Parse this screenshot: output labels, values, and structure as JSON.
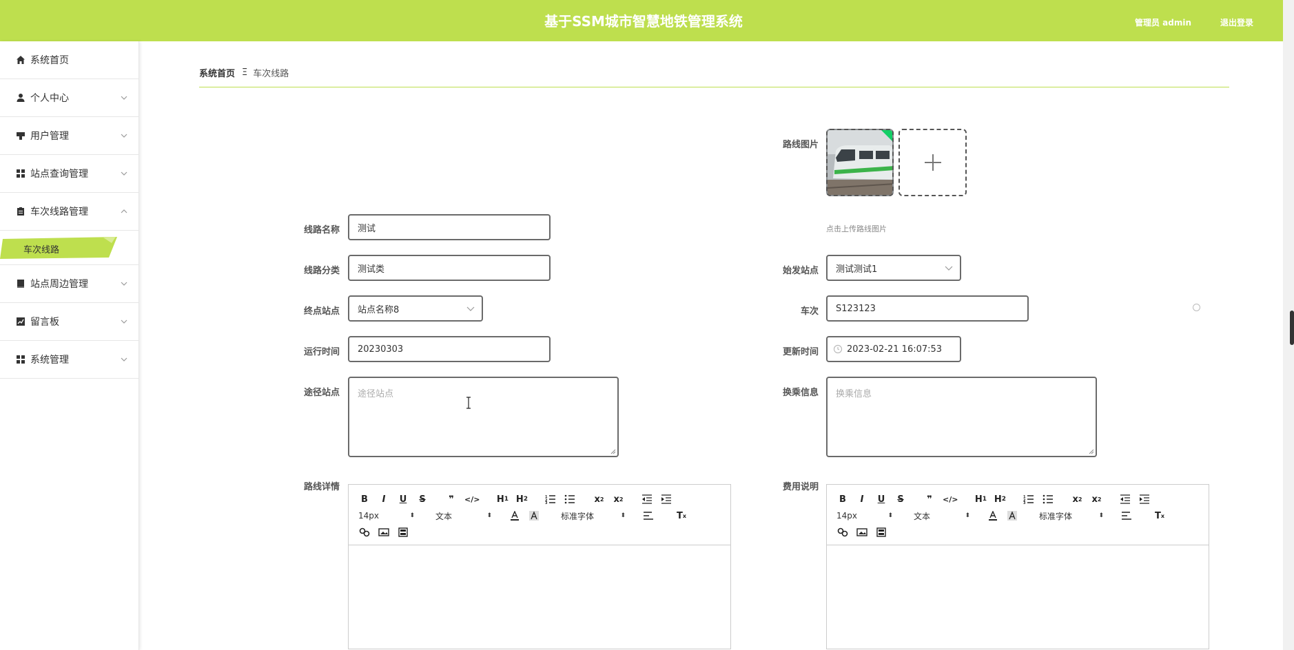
{
  "header": {
    "title": "基于SSM城市智慧地铁管理系统",
    "user": "管理员 admin",
    "logout": "退出登录"
  },
  "sidebar": {
    "items": [
      {
        "label": "系统首页",
        "icon": "home-icon"
      },
      {
        "label": "个人中心",
        "icon": "user-icon"
      },
      {
        "label": "用户管理",
        "icon": "user-manage-icon"
      },
      {
        "label": "站点查询管理",
        "icon": "grid-icon"
      },
      {
        "label": "车次线路管理",
        "icon": "clipboard-icon"
      },
      {
        "label": "站点周边管理",
        "icon": "book-icon"
      },
      {
        "label": "留言板",
        "icon": "chart-icon"
      },
      {
        "label": "系统管理",
        "icon": "grid-icon"
      }
    ],
    "active_sub": "车次线路"
  },
  "breadcrumb": {
    "home": "系统首页",
    "separator": "Ξ",
    "current": "车次线路"
  },
  "form": {
    "route_image_label": "路线图片",
    "upload_tip": "点击上传路线图片",
    "route_name_label": "线路名称",
    "route_name": "测试",
    "route_category_label": "线路分类",
    "route_category": "测试类",
    "start_station_label": "始发站点",
    "start_station": "测试测试1",
    "end_station_label": "终点站点",
    "end_station": "站点名称8",
    "train_no_label": "车次",
    "train_no": "S123123",
    "run_time_label": "运行时间",
    "run_time": "20230303",
    "update_time_label": "更新时间",
    "update_time": "2023-02-21 16:07:53",
    "via_stations_label": "途径站点",
    "via_stations_placeholder": "途径站点",
    "transfer_label": "换乘信息",
    "transfer_placeholder": "换乘信息",
    "route_detail_label": "路线详情",
    "fee_label": "费用说明"
  },
  "editor": {
    "font_size": "14px",
    "text_type": "文本",
    "font_family": "标准字体"
  },
  "colors": {
    "accent": "#bedf4e"
  }
}
